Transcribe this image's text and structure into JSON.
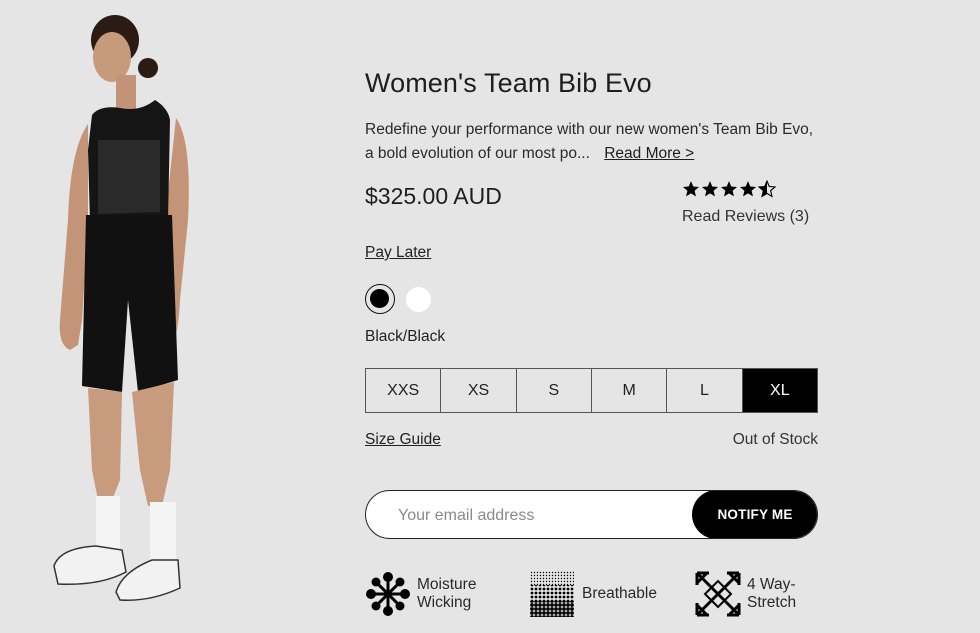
{
  "product": {
    "title": "Women's Team Bib Evo",
    "description": "Redefine your performance with our new women's Team Bib Evo, a bold evolution of our most po...",
    "read_more": "Read More >",
    "price": "$325.00 AUD",
    "rating": 4.5,
    "reviews_label": "Read Reviews (3)",
    "pay_later": "Pay Later"
  },
  "colors": {
    "selected_name": "Black/Black",
    "swatches": [
      "#000000",
      "#ffffff"
    ]
  },
  "sizes": {
    "options": [
      "XXS",
      "XS",
      "S",
      "M",
      "L",
      "XL"
    ],
    "selected": "XL"
  },
  "size_guide": "Size Guide",
  "stock_status": "Out of Stock",
  "notify": {
    "placeholder": "Your email address",
    "button_label": "NOTIFY ME"
  },
  "features": [
    {
      "label_1": "Moisture",
      "label_2": "Wicking",
      "icon": "moisture-wicking-icon"
    },
    {
      "label_1": "Breathable",
      "icon": "breathable-icon"
    },
    {
      "label_1": "4 Way-",
      "label_2": "Stretch",
      "icon": "stretch-icon"
    }
  ]
}
